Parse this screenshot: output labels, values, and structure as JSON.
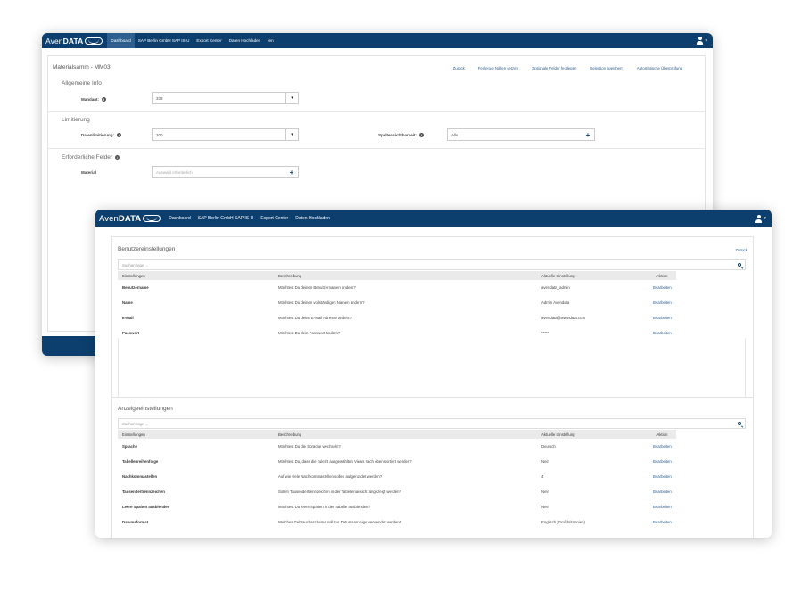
{
  "brand": {
    "prefix": "Aven",
    "suffix": "DATA"
  },
  "window1": {
    "nav": [
      "Dashboard",
      "SAP Berlin GmbH SAP IS-U",
      "Export Center",
      "Daten Hochladen",
      "Ien"
    ],
    "title": "Materialsamm - MM03",
    "actions": [
      "Zurück",
      "Fehlende Nullen setzen",
      "Optionale Felder festlegen",
      "Selektion speichern",
      "Automatische Überprüfung"
    ],
    "sections": {
      "general": {
        "label": "Allgemeine Info",
        "mandant_label": "Mandant:",
        "mandant_value": "333"
      },
      "limit": {
        "label": "Limitierung",
        "data_limit_label": "Datenlimitierung:",
        "data_limit_value": "200",
        "column_vis_label": "Spaltensichtbarkeit:",
        "column_vis_value": "Alle"
      },
      "required": {
        "label": "Erforderliche Felder",
        "material_label": "Material",
        "material_placeholder": "Auswahl erforderlich"
      }
    }
  },
  "window2": {
    "nav": [
      "Dashboard",
      "SAP Berlin GmbH SAP IS-U",
      "Export Center",
      "Daten Hochladen"
    ],
    "user_settings": {
      "title": "Benutzereinstellungen",
      "back": "Zurück",
      "search_placeholder": "Suchanfrage ...",
      "columns": [
        "Einstellungen",
        "Beschreibung",
        "Aktuelle Einstellung",
        "Aktion"
      ],
      "rows": [
        {
          "name": "Benutzername",
          "desc": "Möchtest Du deinen Benutzernamen ändern?",
          "value": "avendata_admin",
          "action": "Bearbeiten"
        },
        {
          "name": "Name",
          "desc": "Möchtest Du deinen vollständigen Namen ändern?",
          "value": "Admin Avendata",
          "action": "Bearbeiten"
        },
        {
          "name": "E-Mail",
          "desc": "Möchtest Du deine E-Mail Adresse ändern?",
          "value": "avendata@avendata.com",
          "action": "Bearbeiten"
        },
        {
          "name": "Passwort",
          "desc": "Möchtest Du dein Passwort ändern?",
          "value": "*****",
          "action": "Bearbeiten"
        }
      ]
    },
    "display_settings": {
      "title": "Anzeigeeinstellungen",
      "search_placeholder": "Suchanfrage ...",
      "columns": [
        "Einstellungen",
        "Beschreibung",
        "Aktuelle Einstellung",
        "Aktion"
      ],
      "rows": [
        {
          "name": "Sprache",
          "desc": "Möchtest Du die Sprache wechseln?",
          "value": "Deutsch",
          "action": "Bearbeiten"
        },
        {
          "name": "Tabellenreihenfolge",
          "desc": "Möchtest Du, dass die zuletzt ausgewählten Views nach oben sortiert werden?",
          "value": "Nein",
          "action": "Bearbeiten"
        },
        {
          "name": "Nachkommastellen",
          "desc": "Auf wie viele Nachkommastellen sollen aufgerundet werden?",
          "value": "4",
          "action": "Bearbeiten"
        },
        {
          "name": "Tausendertrennzeichen",
          "desc": "Sollen Tausendertrennzeichen in der Tabellenansicht angezeigt werden?",
          "value": "Nein",
          "action": "Bearbeiten"
        },
        {
          "name": "Leere Spalten ausblenden",
          "desc": "Möchtest Du leere Spalten in der Tabelle ausblenden?",
          "value": "Nein",
          "action": "Bearbeiten"
        },
        {
          "name": "Datumsformat",
          "desc": "Welches Gebrauchsschema soll zur Datumsanzeige verwendet werden?",
          "value": "Englisch (Großbritannien)",
          "action": "Bearbeiten"
        }
      ]
    }
  },
  "colors": {
    "brand_navy": "#0d3f6e",
    "link_blue": "#2a5b8c",
    "active_tab": "#2c5f8f"
  }
}
